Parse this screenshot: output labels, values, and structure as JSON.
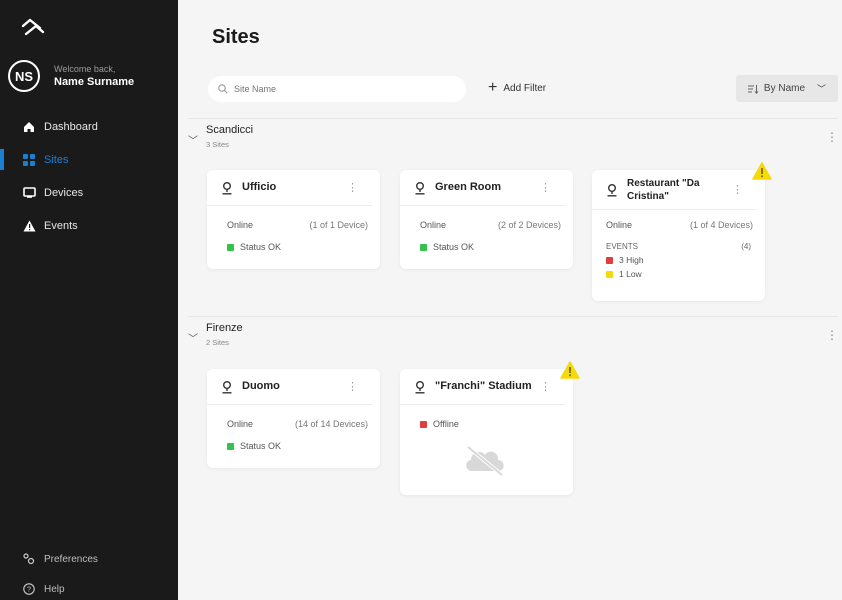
{
  "app": {
    "colors": {
      "accent": "#1a7fd1",
      "ok": "#33c24d",
      "error": "#e23d3d",
      "warning": "#f5d90a"
    }
  },
  "user": {
    "welcome": "Welcome back,",
    "name": "Name Surname",
    "initials": "NS"
  },
  "nav": {
    "items": [
      {
        "label": "Dashboard",
        "icon": "home-icon"
      },
      {
        "label": "Sites",
        "icon": "grid-icon"
      },
      {
        "label": "Devices",
        "icon": "monitor-icon"
      },
      {
        "label": "Events",
        "icon": "warning-icon"
      }
    ],
    "bottom": [
      {
        "label": "Preferences",
        "icon": "sliders-icon"
      },
      {
        "label": "Help",
        "icon": "help-icon"
      }
    ]
  },
  "page": {
    "title": "Sites"
  },
  "toolbar": {
    "search_placeholder": "Site Name",
    "add_filter": "Add Filter",
    "sort": "By Name"
  },
  "groups": [
    {
      "name": "Scandicci",
      "count": "3 Sites",
      "sites": [
        {
          "name": "Ufficio",
          "status": "Online",
          "devices": "(1 of 1 Device)",
          "state": "Status OK"
        },
        {
          "name": "Green Room",
          "status": "Online",
          "devices": "(2 of 2 Devices)",
          "state": "Status OK"
        },
        {
          "name": "Restaurant \"Da Cristina\"",
          "status": "Online",
          "devices": "(1 of 4 Devices)",
          "events_label": "EVENTS",
          "events_count": "(4)",
          "high": "3 High",
          "low": "1 Low"
        }
      ]
    },
    {
      "name": "Firenze",
      "count": "2 Sites",
      "sites": [
        {
          "name": "Duomo",
          "status": "Online",
          "devices": "(14 of 14 Devices)",
          "state": "Status OK"
        },
        {
          "name": "\"Franchi\" Stadium",
          "state": "Offline"
        }
      ]
    }
  ]
}
